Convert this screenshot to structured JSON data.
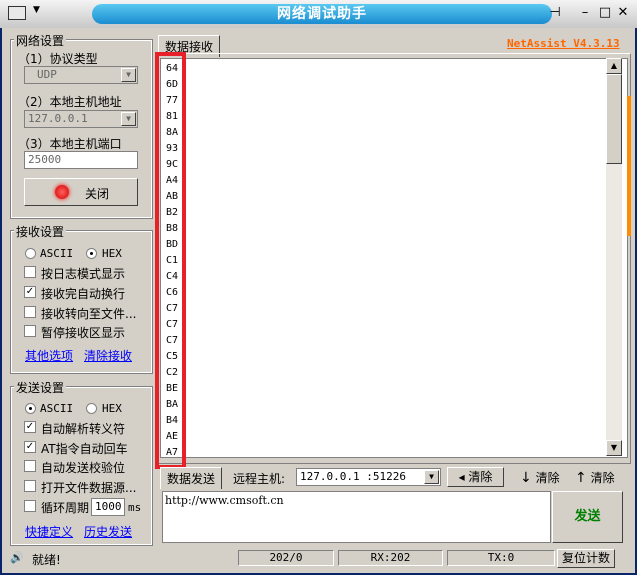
{
  "window": {
    "title": "网络调试助手",
    "version": "NetAssist V4.3.13"
  },
  "network": {
    "title": "网络设置",
    "protocol_label": "（1）协议类型",
    "protocol": "UDP",
    "host_label": "（2）本地主机地址",
    "host": "127.0.0.1",
    "port_label": "（3）本地主机端口",
    "port": "25000",
    "close_label": "关闭"
  },
  "receive": {
    "title": "接收设置",
    "ascii": "ASCII",
    "hex": "HEX",
    "mode": "HEX",
    "options": [
      {
        "label": "按日志模式显示",
        "checked": false
      },
      {
        "label": "接收完自动换行",
        "checked": true
      },
      {
        "label": "接收转向至文件...",
        "checked": false
      },
      {
        "label": "暂停接收区显示",
        "checked": false
      }
    ],
    "link_more": "其他选项",
    "link_clear": "清除接收"
  },
  "send": {
    "title": "发送设置",
    "ascii": "ASCII",
    "hex": "HEX",
    "mode": "ASCII",
    "options": [
      {
        "label": "自动解析转义符",
        "checked": true
      },
      {
        "label": "AT指令自动回车",
        "checked": true
      },
      {
        "label": "自动发送校验位",
        "checked": false
      },
      {
        "label": "打开文件数据源...",
        "checked": false
      }
    ],
    "loop_label": "循环周期",
    "loop_value": "1000",
    "loop_unit": "ms",
    "link_shortcut": "快捷定义",
    "link_history": "历史发送"
  },
  "recv_tab": "数据接收",
  "recv_data": [
    "64",
    "6D",
    "77",
    "81",
    "8A",
    "93",
    "9C",
    "A4",
    "AB",
    "B2",
    "B8",
    "BD",
    "C1",
    "C4",
    "C6",
    "C7",
    "C7",
    "C7",
    "C5",
    "C2",
    "BE",
    "BA",
    "B4",
    "AE",
    "A7"
  ],
  "send_tab": "数据发送",
  "remote_label": "远程主机:",
  "remote_value": "127.0.0.1 :51226",
  "clear1": "清除",
  "clear2": "清除",
  "clear3": "清除",
  "send_text": "http://www.cmsoft.cn",
  "send_button": "发送",
  "statusbar": {
    "ready": "就绪!",
    "count": "202/0",
    "rx": "RX:202",
    "tx": "TX:0",
    "reset": "复位计数"
  },
  "colors": {
    "highlight": "#e8202a",
    "version": "#ff6600",
    "send_button": "#008000"
  }
}
